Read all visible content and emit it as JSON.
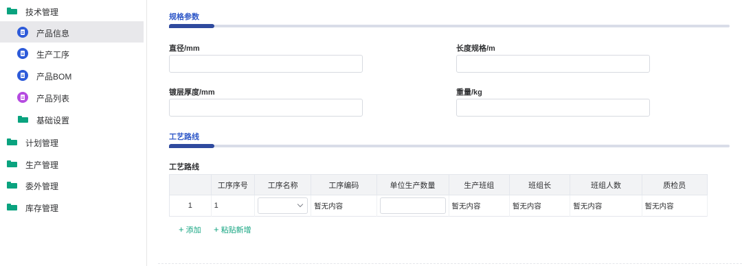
{
  "sidebar": {
    "items": [
      {
        "label": "技术管理",
        "icon": "folder-icon"
      },
      {
        "label": "产品信息",
        "icon": "document-icon",
        "active": true
      },
      {
        "label": "生产工序",
        "icon": "document-icon"
      },
      {
        "label": "产品BOM",
        "icon": "clipboard-icon"
      },
      {
        "label": "产品列表",
        "icon": "list-icon"
      },
      {
        "label": "基础设置",
        "icon": "folder-icon"
      },
      {
        "label": "计划管理",
        "icon": "folder-icon"
      },
      {
        "label": "生产管理",
        "icon": "folder-icon"
      },
      {
        "label": "委外管理",
        "icon": "folder-icon"
      },
      {
        "label": "库存管理",
        "icon": "folder-icon"
      }
    ]
  },
  "colors": {
    "accent": "#2f4a9e",
    "folder": "#0aa37f",
    "blue_icon": "#2e5bd9",
    "purple_icon": "#b54be0",
    "link": "#13a480"
  },
  "spec": {
    "title": "规格参数",
    "fields": [
      {
        "label": "直径/mm",
        "value": ""
      },
      {
        "label": "长度规格/m",
        "value": ""
      },
      {
        "label": "镀层厚度/mm",
        "value": ""
      },
      {
        "label": "重量/kg",
        "value": ""
      }
    ]
  },
  "route": {
    "title": "工艺路线",
    "table_label": "工艺路线",
    "columns": [
      "",
      "工序序号",
      "工序名称",
      "工序编码",
      "单位生产数量",
      "生产班组",
      "班组长",
      "班组人数",
      "质检员"
    ],
    "rows": [
      {
        "index": "1",
        "seq": "1",
        "name": "",
        "code": "暂无内容",
        "qty": "",
        "team": "暂无内容",
        "leader": "暂无内容",
        "count": "暂无内容",
        "inspector": "暂无内容"
      }
    ],
    "add_label": "添加",
    "paste_label": "粘贴新增"
  }
}
